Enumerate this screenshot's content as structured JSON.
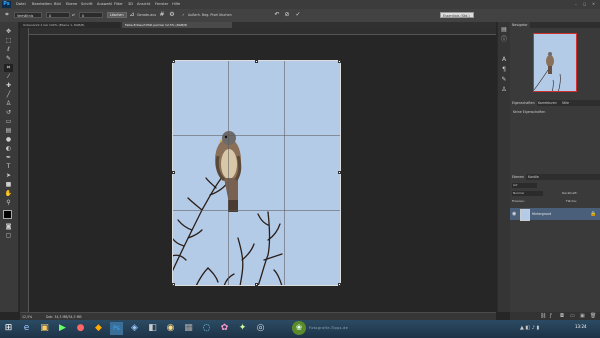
{
  "app": {
    "logo": "Ps"
  },
  "menu": [
    "Datei",
    "Bearbeiten",
    "Bild",
    "Ebene",
    "Schrift",
    "Auswahl",
    "Filter",
    "3D",
    "Ansicht",
    "Fenster",
    "Hilfe"
  ],
  "options": {
    "ratio_value": "Verhältnis",
    "width_value": "0",
    "height_value": "0",
    "clear_label": "Löschen",
    "straighten_label": "Gerade-aus",
    "delete_crop_checkbox": "Außerh. Beg. Pixel löschen",
    "search_placeholder": "Essentials (Std.)"
  },
  "tabs": {
    "doc1": "Unbenannt-1 bei 100% (Ebene 1, RGB/8)",
    "doc2": "Falke-Entwurf-PSD.psd bei 12,5% (RGB/8)"
  },
  "panels": {
    "navigator_tab": "Navigator",
    "properties_tabs": [
      "Eigenschaften",
      "Korrekturen",
      "Stile"
    ],
    "properties_text": "Keine Eigenschaften",
    "layers_tabs": [
      "Ebenen",
      "Kanäle"
    ],
    "blend_mode": "Normal",
    "opacity_label": "Deckkraft:",
    "lock_label": "Fixieren:",
    "fill_label": "Fläche:",
    "kind_filter": "Art",
    "layer_name": "Hintergrund"
  },
  "status": {
    "zoom": "12,5%",
    "doc_size": "Dok: 34,3 MB/34,3 MB"
  },
  "taskbar": {
    "clock": "13:24",
    "watermark": "Fotografie-Tipps.de"
  },
  "colors": {
    "canvas_sky": "#b4cbe8",
    "workspace": "#262626",
    "nav_frame": "#d03030",
    "layer_selected": "#4a5f7a"
  },
  "icons": [
    "move-icon",
    "marquee-icon",
    "lasso-icon",
    "quick-select-icon",
    "crop-icon",
    "eyedropper-icon",
    "healing-icon",
    "brush-icon",
    "stamp-icon",
    "history-brush-icon",
    "eraser-icon",
    "gradient-icon",
    "blur-icon",
    "dodge-icon",
    "pen-icon",
    "type-icon",
    "path-select-icon",
    "shape-icon",
    "hand-icon",
    "zoom-icon"
  ]
}
